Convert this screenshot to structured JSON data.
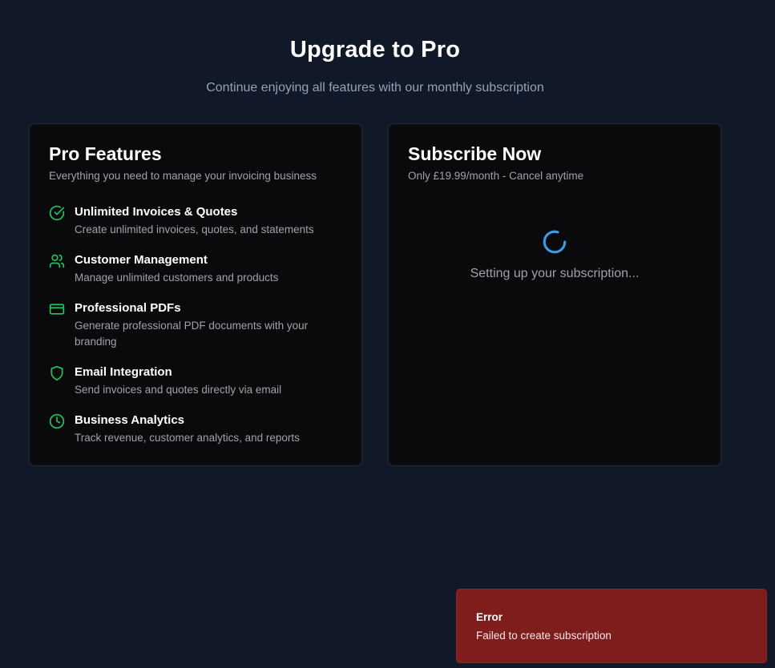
{
  "hero": {
    "title": "Upgrade to Pro",
    "subtitle": "Continue enjoying all features with our monthly subscription"
  },
  "features_card": {
    "title": "Pro Features",
    "description": "Everything you need to manage your invoicing business",
    "items": [
      {
        "icon": "check-circle-icon",
        "title": "Unlimited Invoices & Quotes",
        "description": "Create unlimited invoices, quotes, and statements"
      },
      {
        "icon": "users-icon",
        "title": "Customer Management",
        "description": "Manage unlimited customers and products"
      },
      {
        "icon": "credit-card-icon",
        "title": "Professional PDFs",
        "description": "Generate professional PDF documents with your branding"
      },
      {
        "icon": "shield-icon",
        "title": "Email Integration",
        "description": "Send invoices and quotes directly via email"
      },
      {
        "icon": "clock-icon",
        "title": "Business Analytics",
        "description": "Track revenue, customer analytics, and reports"
      }
    ]
  },
  "subscribe_card": {
    "title": "Subscribe Now",
    "description": "Only £19.99/month - Cancel anytime",
    "loading_text": "Setting up your subscription..."
  },
  "toast": {
    "title": "Error",
    "message": "Failed to create subscription"
  },
  "colors": {
    "background": "#111827",
    "card": "#0a0a0c",
    "accent_green": "#22c55e",
    "spinner_blue": "#3b9ce8",
    "error_red": "#7f1d1d"
  }
}
